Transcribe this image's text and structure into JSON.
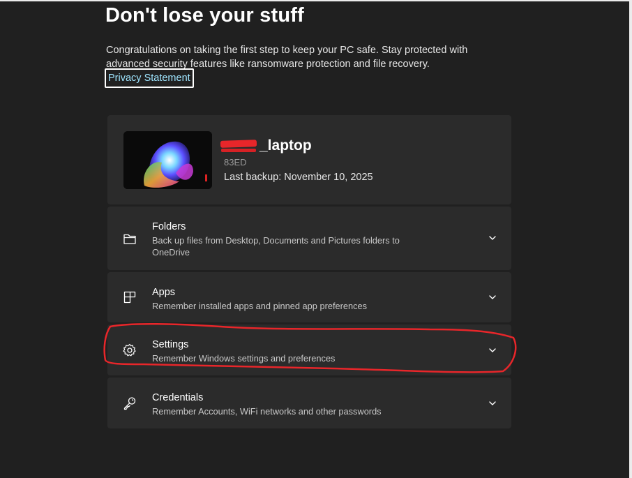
{
  "page": {
    "title": "Don't lose your stuff",
    "description": "Congratulations on taking the first step to keep your PC safe. Stay protected with advanced security features like ransomware protection and file recovery.",
    "privacy_link": "Privacy Statement"
  },
  "device": {
    "name": "_laptop",
    "sub": "83ED",
    "last_backup": "Last backup: November 10, 2025"
  },
  "sections": [
    {
      "title": "Folders",
      "description": "Back up files from Desktop, Documents and Pictures folders to OneDrive",
      "icon": "folder-icon"
    },
    {
      "title": "Apps",
      "description": "Remember installed apps and pinned app preferences",
      "icon": "apps-icon"
    },
    {
      "title": "Settings",
      "description": "Remember Windows settings and preferences",
      "icon": "gear-icon"
    },
    {
      "title": "Credentials",
      "description": "Remember Accounts, WiFi networks and other passwords",
      "icon": "key-icon"
    }
  ],
  "colors": {
    "background": "#202020",
    "card": "#2b2b2b",
    "link": "#9fe5ff",
    "annotation": "#e8262a"
  }
}
